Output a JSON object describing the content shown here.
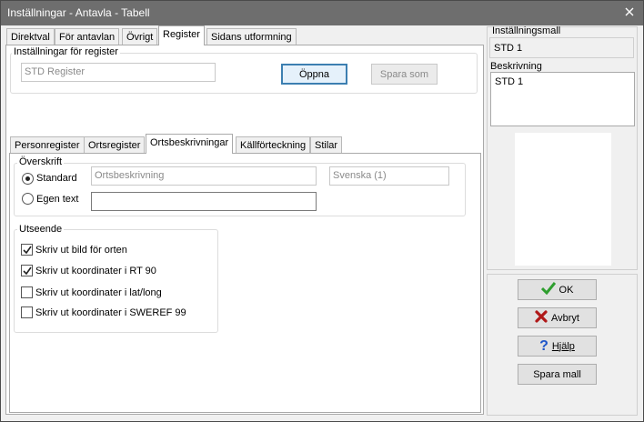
{
  "window": {
    "title": "Inställningar - Antavla - Tabell"
  },
  "top_tabs": [
    "Direktval",
    "För antavlan",
    "Övrigt",
    "Register",
    "Sidans utformning"
  ],
  "register_settings": {
    "group_title": "Inställningar för register",
    "template_value": "STD Register",
    "open_label": "Öppna",
    "save_as_label": "Spara som"
  },
  "sub_tabs": [
    "Personregister",
    "Ortsregister",
    "Ortsbeskrivningar",
    "Källförteckning",
    "Stilar"
  ],
  "heading": {
    "group_title": "Överskrift",
    "standard_label": "Standard",
    "standard_value": "Ortsbeskrivning",
    "language_value": "Svenska (1)",
    "custom_label": "Egen text",
    "custom_value": ""
  },
  "appearance": {
    "group_title": "Utseende",
    "options": [
      {
        "label": "Skriv ut bild för orten",
        "checked": true
      },
      {
        "label": "Skriv ut koordinater i RT 90",
        "checked": true
      },
      {
        "label": "Skriv ut koordinater i lat/long",
        "checked": false
      },
      {
        "label": "Skriv ut koordinater i SWEREF 99",
        "checked": false
      }
    ]
  },
  "right_panel": {
    "template_title": "Inställningsmall",
    "template_value": "STD 1",
    "description_title": "Beskrivning",
    "description_value": "STD 1"
  },
  "buttons": {
    "ok": "OK",
    "cancel": "Avbryt",
    "help": "Hjälp",
    "save_template": "Spara mall"
  },
  "colors": {
    "titlebar": "#6e6e6e",
    "ok_check": "#2e9e2e",
    "cancel_x": "#b01818",
    "help_q": "#1f56c9"
  }
}
